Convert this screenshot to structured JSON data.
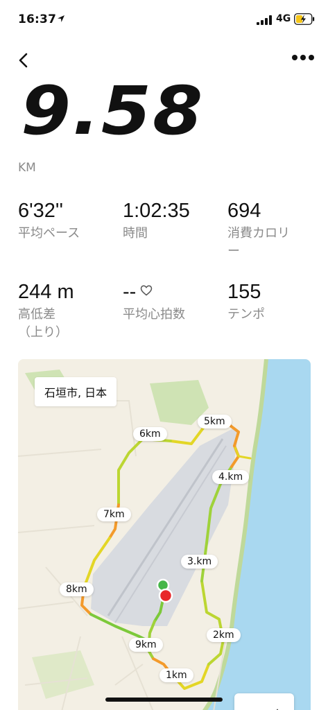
{
  "status_bar": {
    "time": "16:37",
    "network": "4G"
  },
  "workout": {
    "distance": "9.58",
    "unit": "KM"
  },
  "stats": [
    {
      "value": "6'32''",
      "label": "平均ペース"
    },
    {
      "value": "1:02:35",
      "label": "時間"
    },
    {
      "value": "694",
      "label": "消費カロリ\nー"
    },
    {
      "value": "244 m",
      "label": "高低差\n（上り）"
    },
    {
      "value": "--",
      "label": "平均心拍数"
    },
    {
      "value": "155",
      "label": "テンポ"
    }
  ],
  "map": {
    "place": "石垣市, 日本",
    "km_markers": [
      "1km",
      "2km",
      "3.km",
      "4.km",
      "5km",
      "6km",
      "7km",
      "8km",
      "9km"
    ]
  },
  "colors": {
    "route_green": "#7cc93a",
    "route_yellow": "#e3d626",
    "route_orange": "#f39a2b",
    "route_red": "#e8433b",
    "sea": "#a9d8f0",
    "airport": "#d8dbe0"
  },
  "icons": [
    "location-arrow-icon",
    "signal-icon",
    "battery-icon",
    "back-icon",
    "more-icon",
    "heart-icon",
    "map-toggle-icon"
  ]
}
